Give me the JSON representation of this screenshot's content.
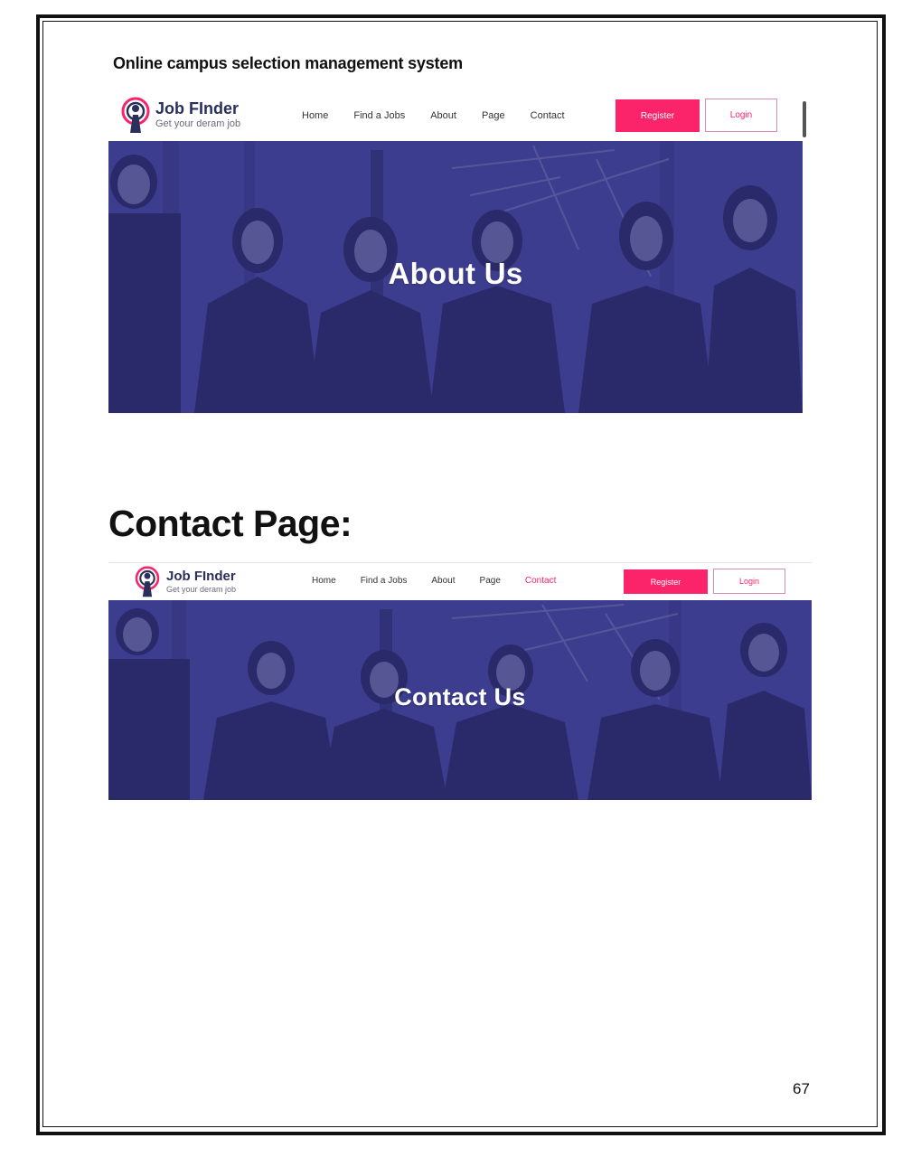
{
  "document": {
    "header": "Online campus selection management system",
    "section_heading": "Contact Page:",
    "page_number": "67"
  },
  "about_screenshot": {
    "logo": {
      "title": "Job FInder",
      "tagline": "Get your deram job",
      "icon": "target-person-icon"
    },
    "nav": [
      "Home",
      "Find a Jobs",
      "About",
      "Page",
      "Contact"
    ],
    "register_label": "Register",
    "login_label": "Login",
    "hero_title": "About Us"
  },
  "contact_screenshot": {
    "logo": {
      "title": "Job FInder",
      "tagline": "Get your deram job",
      "icon": "target-person-icon"
    },
    "nav": [
      "Home",
      "Find a Jobs",
      "About",
      "Page",
      "Contact"
    ],
    "active_nav": "Contact",
    "register_label": "Register",
    "login_label": "Login",
    "hero_title": "Contact Us"
  },
  "colors": {
    "accent": "#fb246a",
    "hero_overlay": "#3a3a8c",
    "logo_text": "#2a2f5b"
  }
}
